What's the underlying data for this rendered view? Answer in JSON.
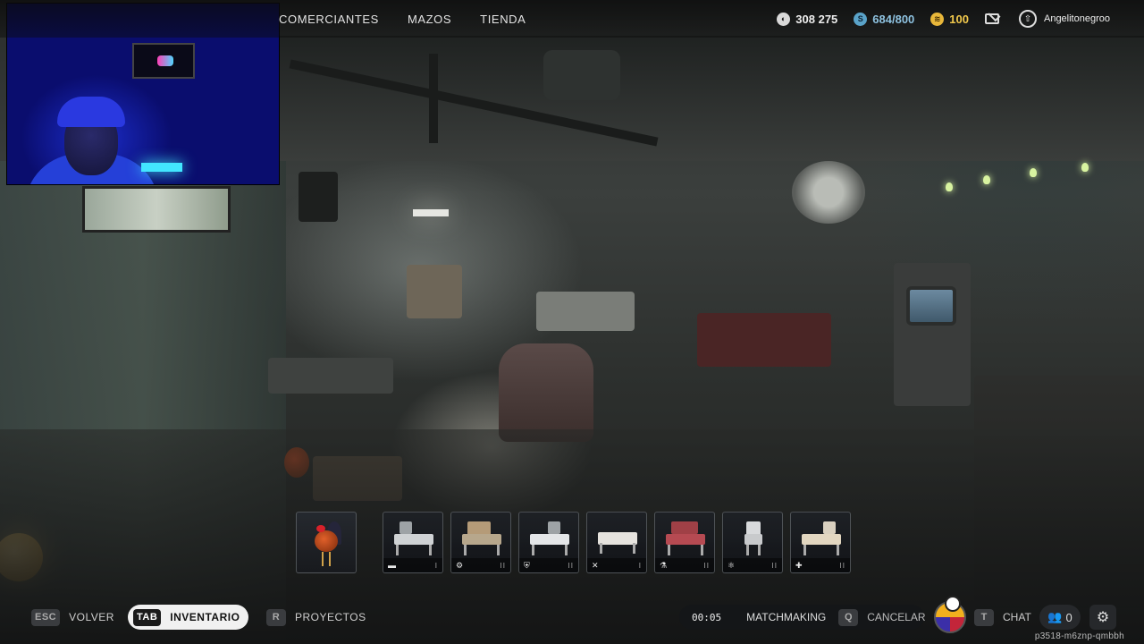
{
  "nav": {
    "items": [
      {
        "label": "COMERCIANTES"
      },
      {
        "label": "MAZOS"
      },
      {
        "label": "TIENDA"
      }
    ]
  },
  "currencies": {
    "rigs": {
      "value": "308 275",
      "icon": "rig-coin-icon"
    },
    "stash": {
      "value": "684/800",
      "icon": "s-coin-icon",
      "glyph": "S"
    },
    "gold": {
      "value": "100",
      "icon": "gold-coin-icon"
    }
  },
  "profile": {
    "username": "Angelitonegroo"
  },
  "hotbar": {
    "slots": [
      {
        "name": "rooster",
        "type_icon": "",
        "tier": ""
      },
      {
        "name": "workbench-1",
        "type_icon": "▬",
        "tier": "I"
      },
      {
        "name": "workbench-2",
        "type_icon": "⚙",
        "tier": "II"
      },
      {
        "name": "workbench-3",
        "type_icon": "⛨",
        "tier": "II"
      },
      {
        "name": "workbench-4",
        "type_icon": "✕",
        "tier": "I"
      },
      {
        "name": "workbench-5",
        "type_icon": "⚗",
        "tier": "II"
      },
      {
        "name": "workbench-6",
        "type_icon": "⚛",
        "tier": "II"
      },
      {
        "name": "workbench-7",
        "type_icon": "✚",
        "tier": "II"
      }
    ]
  },
  "bottombar": {
    "back": {
      "key": "ESC",
      "label": "VOLVER"
    },
    "inventory": {
      "key": "TAB",
      "label": "INVENTARIO"
    },
    "projects": {
      "key": "R",
      "label": "PROYECTOS"
    },
    "matchmaking": {
      "time": "00:05",
      "label": "MATCHMAKING",
      "cancel_key": "Q",
      "cancel_label": "CANCELAR"
    },
    "chat": {
      "key": "T",
      "label": "CHAT"
    },
    "party": {
      "count": "0"
    }
  },
  "session_code": "p3518-m6znp-qmbbh"
}
